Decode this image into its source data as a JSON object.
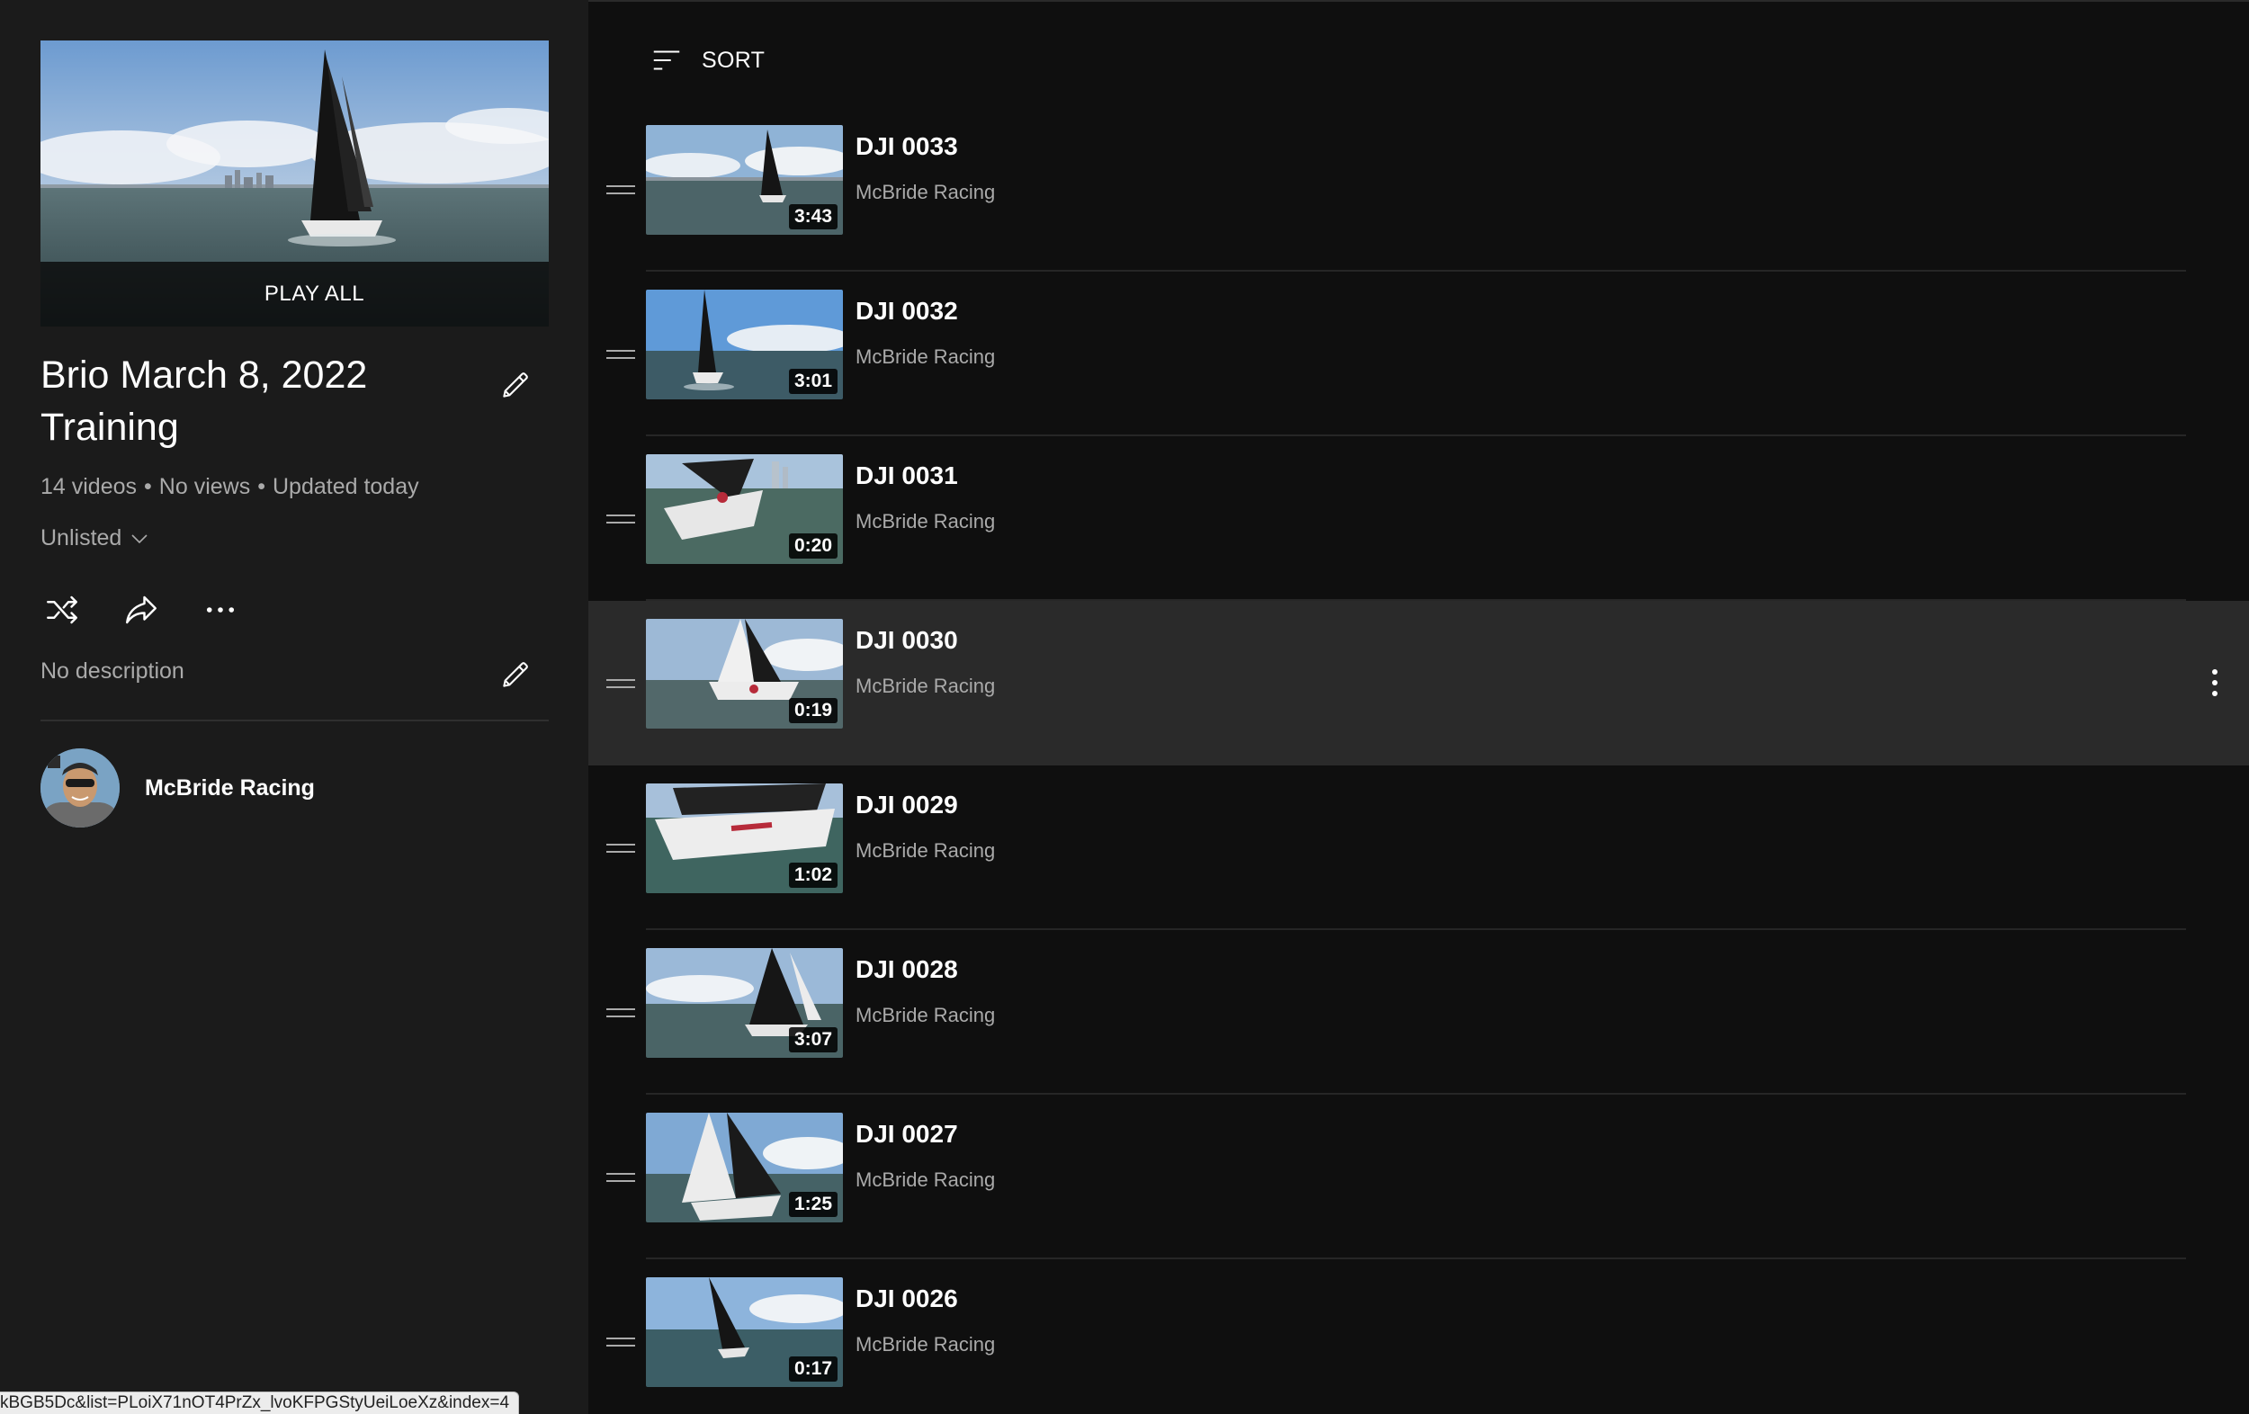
{
  "playlist": {
    "title": "Brio March 8, 2022 Training",
    "play_all_label": "PLAY ALL",
    "meta": {
      "videos": "14 videos",
      "views": "No views",
      "updated": "Updated today",
      "separator": "•"
    },
    "privacy": "Unlisted",
    "description": "No description",
    "owner": "McBride Racing"
  },
  "icons": {
    "edit": "pencil-icon",
    "shuffle": "shuffle-icon",
    "share": "share-icon",
    "more": "more-horizontal-icon",
    "sort": "sort-icon",
    "drag": "drag-handle-icon",
    "menu": "more-vertical-icon"
  },
  "sort": {
    "label": "SORT"
  },
  "videos": [
    {
      "title": "DJI 0033",
      "channel": "McBride Racing",
      "duration": "3:43"
    },
    {
      "title": "DJI 0032",
      "channel": "McBride Racing",
      "duration": "3:01"
    },
    {
      "title": "DJI 0031",
      "channel": "McBride Racing",
      "duration": "0:20"
    },
    {
      "title": "DJI 0030",
      "channel": "McBride Racing",
      "duration": "0:19"
    },
    {
      "title": "DJI 0029",
      "channel": "McBride Racing",
      "duration": "1:02"
    },
    {
      "title": "DJI 0028",
      "channel": "McBride Racing",
      "duration": "3:07"
    },
    {
      "title": "DJI 0027",
      "channel": "McBride Racing",
      "duration": "1:25"
    },
    {
      "title": "DJI 0026",
      "channel": "McBride Racing",
      "duration": "0:17"
    }
  ],
  "status_bar": {
    "url": "kBGB5Dc&list=PLoiX71nOT4PrZx_lvoKFPGStyUeiLoeXz&index=4"
  },
  "colors": {
    "background": "#0f0f0f",
    "sidebar": "#1b1b1b",
    "hover_row": "#2a2a2a",
    "secondary_text": "#aaaaaa"
  }
}
